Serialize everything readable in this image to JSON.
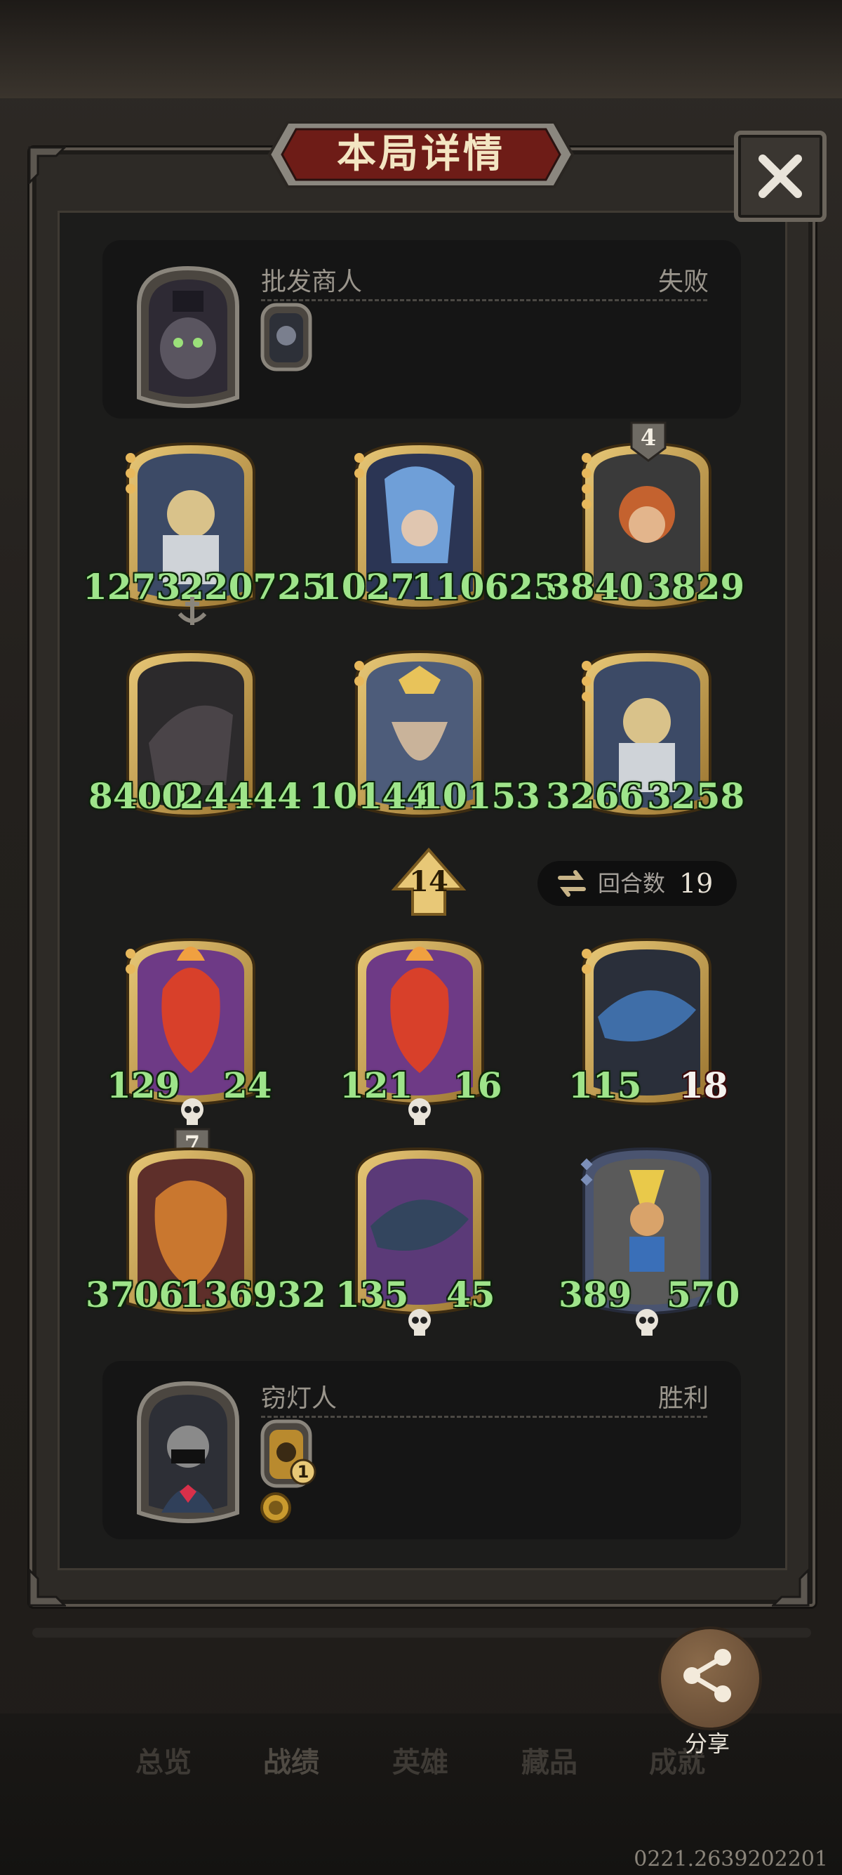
{
  "title": "本局详情",
  "opponent": {
    "name": "批发商人",
    "result": "失败"
  },
  "player": {
    "name": "窃灯人",
    "result": "胜利",
    "item_badge": "1"
  },
  "opponent_board": [
    {
      "attack": "1273",
      "health": "220725",
      "tier_badge": ""
    },
    {
      "attack": "1027",
      "health": "110625",
      "tier_badge": ""
    },
    {
      "attack": "3840",
      "health": "3829",
      "tier_badge": "4"
    },
    {
      "attack": "8400",
      "health": "24444",
      "tier_badge": ""
    },
    {
      "attack": "10144",
      "health": "10153",
      "tier_badge": ""
    },
    {
      "attack": "3266",
      "health": "3258",
      "tier_badge": ""
    }
  ],
  "player_board": [
    {
      "attack": "129",
      "health": "24",
      "tier_badge": ""
    },
    {
      "attack": "121",
      "health": "16",
      "tier_badge": ""
    },
    {
      "attack": "115",
      "health": "18",
      "tier_badge": ""
    },
    {
      "attack": "3706",
      "health": "136932",
      "tier_badge": "7"
    },
    {
      "attack": "135",
      "health": "45",
      "tier_badge": ""
    },
    {
      "attack": "389",
      "health": "570",
      "tier_badge": ""
    }
  ],
  "tier": "14",
  "round": {
    "label": "回合数",
    "value": "19"
  },
  "share_label": "分享",
  "nav": [
    "总览",
    "战绩",
    "英雄",
    "藏品",
    "成就"
  ],
  "version": "0221.2639202201",
  "colors": {
    "stat_green": "#9ee48a",
    "gold_frame": "#c9a24a",
    "panel_bg": "#151515"
  }
}
